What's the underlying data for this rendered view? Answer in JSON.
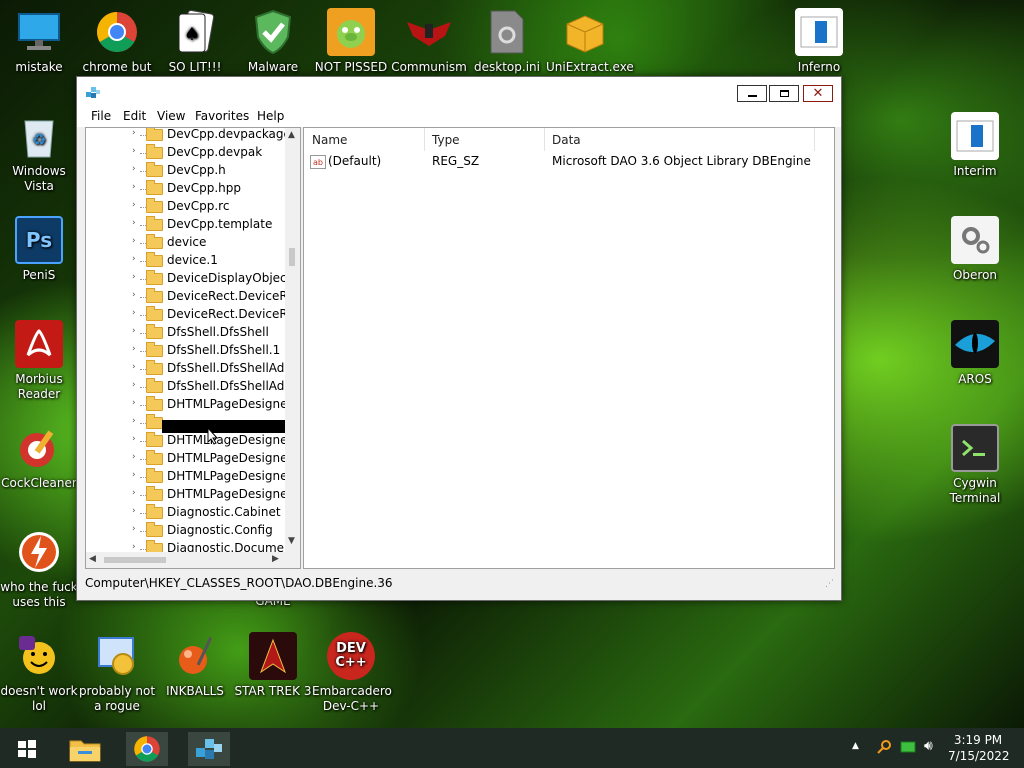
{
  "desktop": {
    "icons_top": [
      {
        "label": "mistake",
        "icon": "monitor-icon",
        "color": "#1e8fd6"
      },
      {
        "label": "chrome but",
        "icon": "chrome-icon",
        "color": "#4285f4"
      },
      {
        "label": "SO LIT!!! AIRE",
        "icon": "solitaire-cards-icon",
        "color": "#ffffff"
      },
      {
        "label": "Malware",
        "icon": "shield-check-icon",
        "color": "#4aa84a"
      },
      {
        "label": "NOT PISSED",
        "icon": "angry-pig-icon",
        "color": "#f0a020"
      },
      {
        "label": "Communism",
        "icon": "eagle-emblem-icon",
        "color": "#c01818"
      },
      {
        "label": "desktop.ini",
        "icon": "settings-file-icon",
        "color": "#7a7a7a"
      },
      {
        "label": "UniExtract.exe",
        "icon": "package-box-icon",
        "color": "#f2b52a"
      },
      {
        "label": "Inferno",
        "icon": "document-blue-icon",
        "color": "#1a73c8"
      }
    ],
    "icons_left": [
      {
        "label": "Windows Vista",
        "icon": "recycle-bin-icon",
        "color": "#2d87c8"
      },
      {
        "label": "PeniS",
        "icon": "photoshop-icon",
        "color": "#0d3b66",
        "text": "Ps"
      },
      {
        "label": "Morbius Reader",
        "icon": "pdf-reader-icon",
        "color": "#c41a16"
      },
      {
        "label": "CockCleaner",
        "icon": "ccleaner-icon",
        "color": "#d2332b"
      },
      {
        "label": "who the fuck uses this",
        "icon": "flash-bolt-icon",
        "color": "#e0531b"
      }
    ],
    "icons_right": [
      {
        "label": "Interim",
        "icon": "document-blue-icon",
        "color": "#1a73c8"
      },
      {
        "label": "Oberon",
        "icon": "settings-gears-icon",
        "color": "#8a8a8a"
      },
      {
        "label": "AROS",
        "icon": "cat-eye-icon",
        "color": "#1b7fb8"
      },
      {
        "label": "Cygwin Terminal",
        "icon": "terminal-icon",
        "color": "#2a2a2a"
      }
    ],
    "icons_bottom": [
      {
        "label": "doesn't work lol",
        "icon": "yahoo-messenger-icon",
        "color": "#6b2c91"
      },
      {
        "label": "probably not a rogue",
        "icon": "gear-window-icon",
        "color": "#3b7bd1"
      },
      {
        "label": "INKBALLS",
        "icon": "inkball-icon",
        "color": "#e85c1a"
      },
      {
        "label": "STAR TREK 3",
        "icon": "star-trek-icon",
        "color": "#b31818"
      },
      {
        "label": "Embarcadero Dev-C++",
        "icon": "devcpp-icon",
        "color": "#c9261e",
        "text": "DEV C++"
      }
    ],
    "partial_label": "GAME"
  },
  "window": {
    "title": "",
    "menu": [
      "File",
      "Edit",
      "View",
      "Favorites",
      "Help"
    ],
    "tree_items": [
      "DevCpp.devpackage",
      "DevCpp.devpak",
      "DevCpp.h",
      "DevCpp.hpp",
      "DevCpp.rc",
      "DevCpp.template",
      "device",
      "device.1",
      "DeviceDisplayObject",
      "DeviceRect.DeviceRec",
      "DeviceRect.DeviceRec",
      "DfsShell.DfsShell",
      "DfsShell.DfsShell.1",
      "DfsShell.DfsShellAdm",
      "DfsShell.DfsShellAdm",
      "DHTMLPageDesigner",
      "",
      "DHTMLPageDesigner",
      "DHTMLPageDesigner",
      "DHTMLPageDesigner",
      "DHTMLPageDesigner",
      "Diagnostic.Cabinet",
      "Diagnostic.Config",
      "Diagnostic.Document"
    ],
    "columns": [
      "Name",
      "Type",
      "Data"
    ],
    "rows": [
      {
        "name": "(Default)",
        "type": "REG_SZ",
        "data": "Microsoft DAO 3.6 Object Library DBEngine"
      }
    ],
    "status_path": "Computer\\HKEY_CLASSES_ROOT\\DAO.DBEngine.36"
  },
  "taskbar": {
    "pinned": [
      "start-windows-icon",
      "file-explorer-icon",
      "chrome-icon",
      "regedit-icon"
    ],
    "clock_time": "3:19 PM",
    "clock_date": "7/15/2022"
  }
}
